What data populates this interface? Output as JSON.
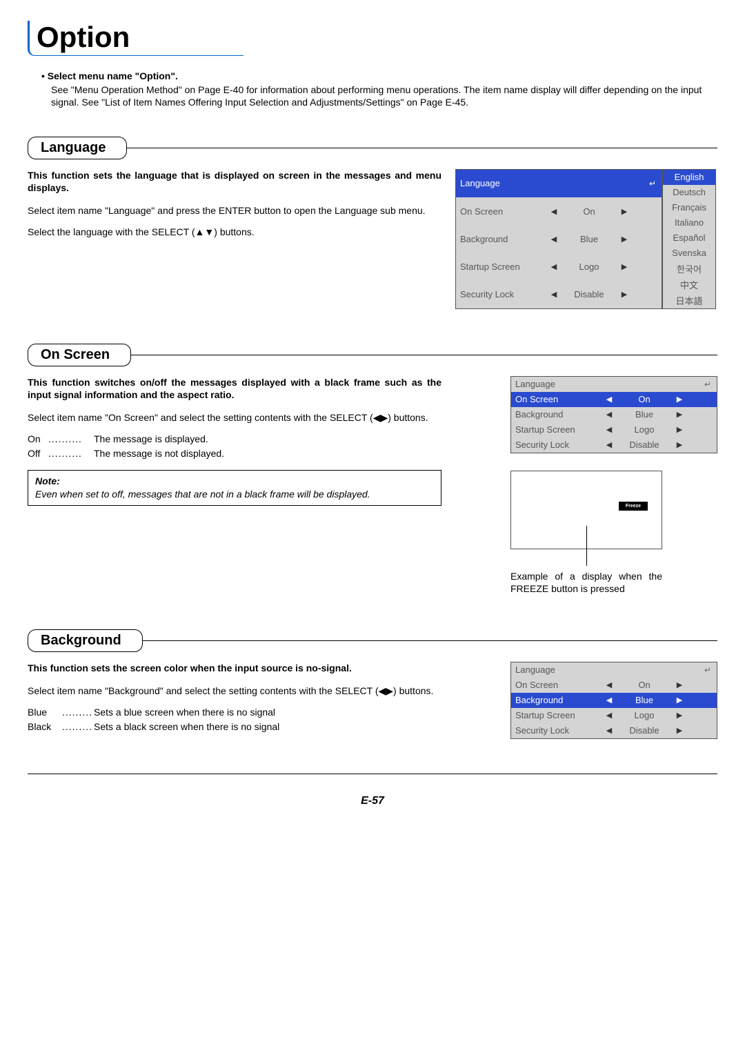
{
  "page_title": "Option",
  "intro": {
    "bullet": "• Select menu name \"Option\".",
    "text": "See \"Menu Operation Method\" on Page E-40 for information about performing menu operations. The item name display will differ depending on the input signal. See \"List of Item Names Offering Input Selection and Adjustments/Settings\" on Page E-45."
  },
  "sections": {
    "language": {
      "title": "Language",
      "bold": "This function sets the language that is displayed on screen in the messages and menu displays.",
      "p1": "Select item name \"Language\" and press the ENTER button to open the Language sub menu.",
      "p2": "Select the language with the SELECT (▲▼) buttons.",
      "menu": [
        {
          "name": "Language",
          "value": "",
          "icon": "↵",
          "highlight": true
        },
        {
          "name": "On Screen",
          "value": "On"
        },
        {
          "name": "Background",
          "value": "Blue"
        },
        {
          "name": "Startup Screen",
          "value": "Logo"
        },
        {
          "name": "Security Lock",
          "value": "Disable"
        }
      ],
      "languages": [
        {
          "name": "English",
          "highlight": true
        },
        {
          "name": "Deutsch"
        },
        {
          "name": "Français"
        },
        {
          "name": "Italiano"
        },
        {
          "name": "Español"
        },
        {
          "name": "Svenska"
        },
        {
          "name": "한국어"
        },
        {
          "name": "中文"
        },
        {
          "name": "日本語"
        }
      ]
    },
    "onscreen": {
      "title": "On Screen",
      "bold": "This function switches on/off the messages displayed with a black frame such as the input signal information and the aspect ratio.",
      "p1": "Select item name \"On Screen\" and select the setting contents with the SELECT (◀▶) buttons.",
      "options": [
        {
          "label": "On",
          "desc": "The message is displayed."
        },
        {
          "label": "Off",
          "desc": "The message is not displayed."
        }
      ],
      "note_title": "Note:",
      "note_text": "Even when set to off, messages that are not in a black frame will be displayed.",
      "menu": [
        {
          "name": "Language",
          "value": "",
          "icon": "↵"
        },
        {
          "name": "On Screen",
          "value": "On",
          "highlight": true
        },
        {
          "name": "Background",
          "value": "Blue"
        },
        {
          "name": "Startup Screen",
          "value": "Logo"
        },
        {
          "name": "Security Lock",
          "value": "Disable"
        }
      ],
      "freeze_label": "Freeze",
      "freeze_caption": "Example of a display when the FREEZE button is pressed"
    },
    "background": {
      "title": "Background",
      "bold": "This function sets the screen color when the input source is no-signal.",
      "p1": "Select item name \"Background\" and select the setting contents with the SELECT (◀▶) buttons.",
      "options": [
        {
          "label": "Blue",
          "desc": "Sets a blue screen when there is no signal"
        },
        {
          "label": "Black",
          "desc": "Sets a black screen when there is no signal"
        }
      ],
      "menu": [
        {
          "name": "Language",
          "value": "",
          "icon": "↵"
        },
        {
          "name": "On Screen",
          "value": "On"
        },
        {
          "name": "Background",
          "value": "Blue",
          "highlight": true
        },
        {
          "name": "Startup Screen",
          "value": "Logo"
        },
        {
          "name": "Security Lock",
          "value": "Disable"
        }
      ]
    }
  },
  "arrows": {
    "left": "◀",
    "right": "▶"
  },
  "page_number": "E-57"
}
